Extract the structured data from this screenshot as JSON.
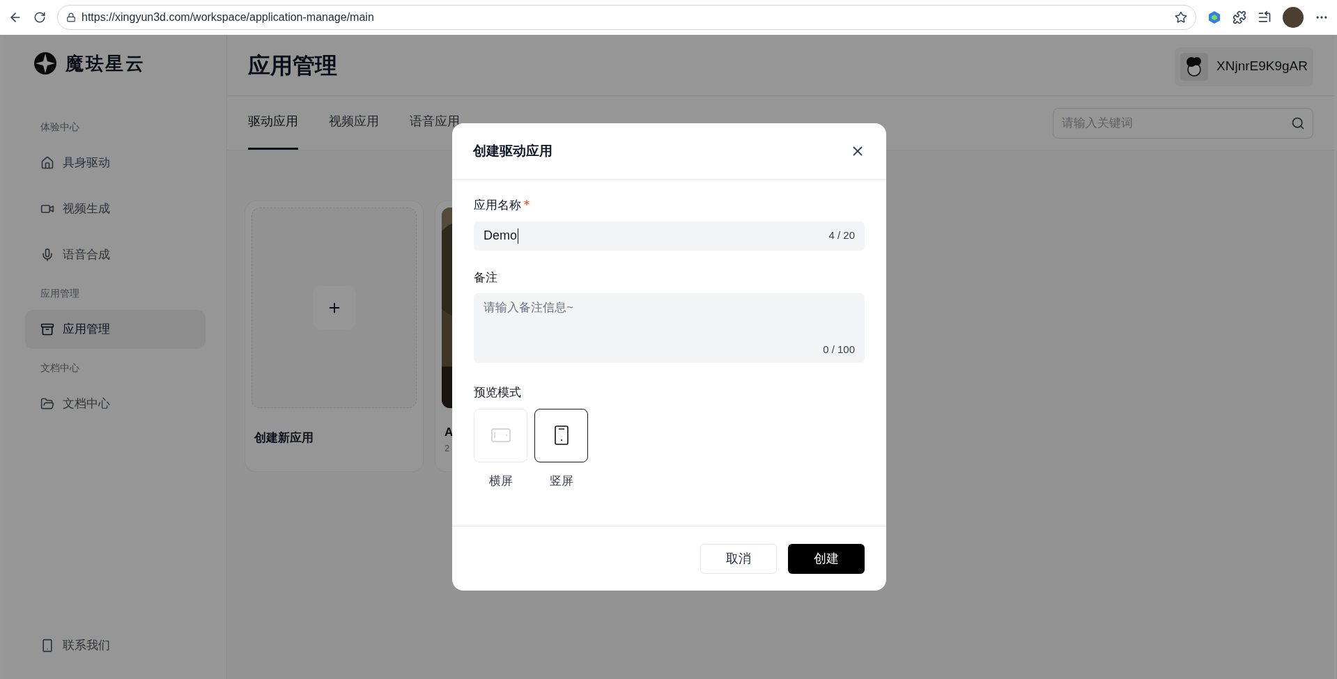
{
  "browser": {
    "url": "https://xingyun3d.com/workspace/application-manage/main"
  },
  "sidebar": {
    "brand": "魔珐星云",
    "sections": [
      {
        "title": "体验中心",
        "items": [
          {
            "label": "具身驱动",
            "selected": false
          },
          {
            "label": "视频生成",
            "selected": false
          },
          {
            "label": "语音合成",
            "selected": false
          }
        ]
      },
      {
        "title": "应用管理",
        "items": [
          {
            "label": "应用管理",
            "selected": true
          }
        ]
      },
      {
        "title": "文档中心",
        "items": [
          {
            "label": "文档中心",
            "selected": false
          }
        ]
      }
    ],
    "footer_item": {
      "label": "联系我们"
    }
  },
  "header": {
    "title": "应用管理",
    "user": "XNjnrE9K9gAR"
  },
  "tabs": [
    {
      "label": "驱动应用",
      "selected": true
    },
    {
      "label": "视频应用",
      "selected": false
    },
    {
      "label": "语音应用",
      "selected": false
    }
  ],
  "search": {
    "placeholder": "请输入关键词"
  },
  "cards": [
    {
      "kind": "new",
      "title": "创建新应用"
    },
    {
      "kind": "app",
      "title": "A",
      "subtitle": "2"
    }
  ],
  "dialog": {
    "title": "创建驱动应用",
    "name_field": {
      "label": "应用名称",
      "required": true,
      "value": "Demo",
      "counter": "4 / 20"
    },
    "remark_field": {
      "label": "备注",
      "placeholder": "请输入备注信息~",
      "counter": "0 / 100"
    },
    "preview": {
      "label": "预览模式",
      "options": [
        {
          "kind": "landscape",
          "label": "横屏",
          "selected": false
        },
        {
          "kind": "portrait",
          "label": "竖屏",
          "selected": true
        }
      ]
    },
    "buttons": [
      {
        "kind": "secondary",
        "label": "取消"
      },
      {
        "kind": "primary",
        "label": "创建"
      }
    ]
  }
}
